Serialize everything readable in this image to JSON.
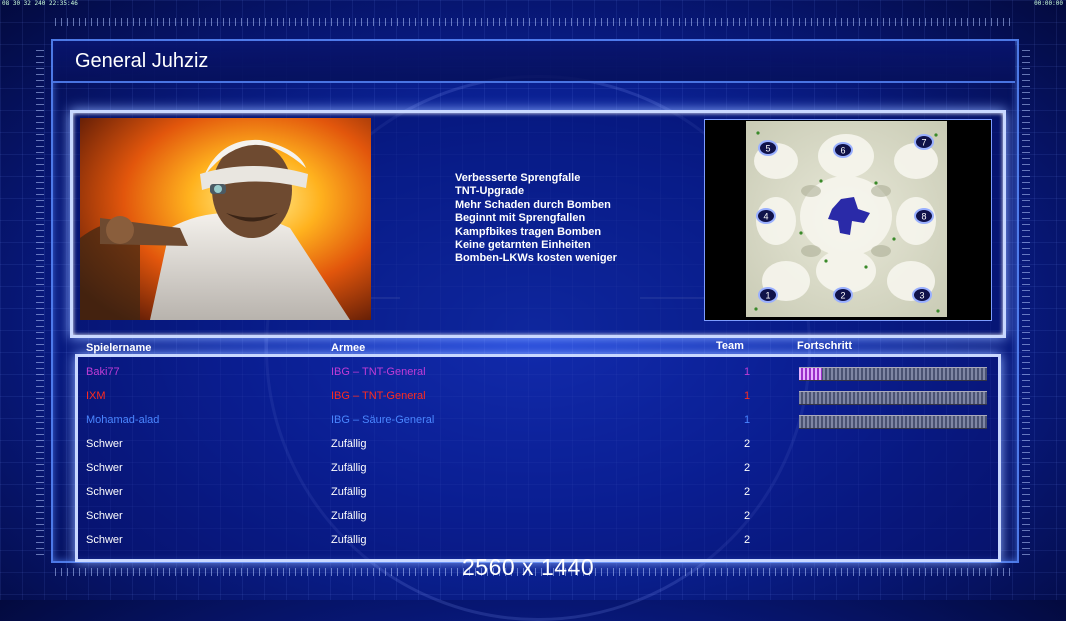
{
  "hud": {
    "top_left": "08 30 32 240 22:35:46",
    "top_right": "00:00:00"
  },
  "title": "General Juhziz",
  "general_bonuses": [
    "Verbesserte Sprengfalle",
    "TNT-Upgrade",
    "Mehr Schaden durch Bomben",
    "Beginnt mit Sprengfallen",
    "Kampfbikes tragen Bomben",
    "Keine getarnten Einheiten",
    "Bomben-LKWs kosten weniger"
  ],
  "map": {
    "start_positions": [
      "1",
      "2",
      "3",
      "4",
      "5",
      "6",
      "7",
      "8"
    ]
  },
  "table": {
    "headers": {
      "player": "Spielername",
      "army": "Armee",
      "team": "Team",
      "progress": "Fortschritt"
    },
    "rows": [
      {
        "name": "Baki77",
        "army": "IBG – TNT-General",
        "team": "1",
        "color": "#c13cd6",
        "progress": 0.12
      },
      {
        "name": "IXM",
        "army": "IBG – TNT-General",
        "team": "1",
        "color": "#ff2b1e",
        "progress": 0.0
      },
      {
        "name": "Mohamad-alad",
        "army": "IBG – Säure-General",
        "team": "1",
        "color": "#4a86ff",
        "progress": 0.0
      },
      {
        "name": "Schwer",
        "army": "Zufällig",
        "team": "2",
        "color": "#ffffff"
      },
      {
        "name": "Schwer",
        "army": "Zufällig",
        "team": "2",
        "color": "#ffffff"
      },
      {
        "name": "Schwer",
        "army": "Zufällig",
        "team": "2",
        "color": "#ffffff"
      },
      {
        "name": "Schwer",
        "army": "Zufällig",
        "team": "2",
        "color": "#ffffff"
      },
      {
        "name": "Schwer",
        "army": "Zufällig",
        "team": "2",
        "color": "#ffffff"
      }
    ]
  },
  "resolution_watermark": "2560 x 1440"
}
